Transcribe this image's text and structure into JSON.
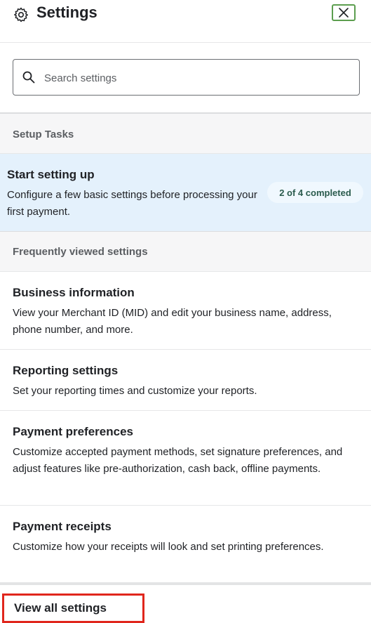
{
  "header": {
    "title": "Settings",
    "close_icon": "close-icon",
    "settings_icon": "gear-icon"
  },
  "search": {
    "placeholder": "Search settings",
    "value": ""
  },
  "setup_section": {
    "label": "Setup Tasks",
    "card": {
      "title": "Start setting up",
      "description": "Configure a few basic settings before processing your first payment.",
      "badge": "2 of 4 completed"
    }
  },
  "frequent_section": {
    "label": "Frequently viewed settings",
    "items": [
      {
        "title": "Business information",
        "description": "View your Merchant ID (MID) and edit your business name, address, phone number, and more."
      },
      {
        "title": "Reporting settings",
        "description": "Set your reporting times and customize your reports."
      },
      {
        "title": "Payment preferences",
        "description": "Customize accepted payment methods, set signature preferences, and adjust features like pre-authorization, cash back, offline payments."
      },
      {
        "title": "Payment receipts",
        "description": "Customize how your receipts will look and set printing preferences."
      }
    ]
  },
  "footer": {
    "view_all_label": "View all settings"
  },
  "colors": {
    "accent_green": "#5c9e4f",
    "highlight_red": "#e0261c",
    "setup_bg": "#e4f1fc"
  }
}
